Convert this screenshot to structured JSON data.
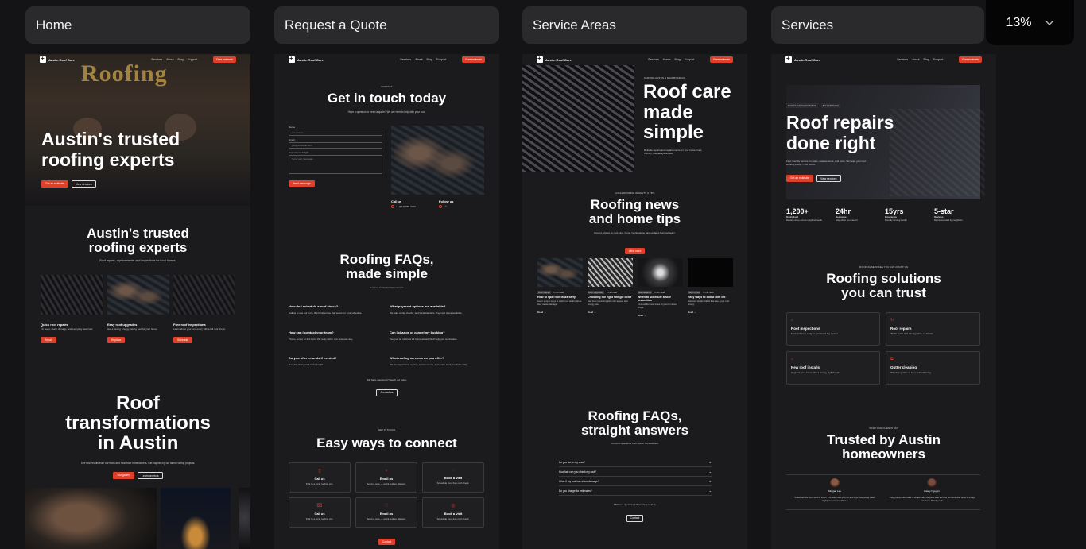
{
  "tabs": [
    {
      "label": "Home"
    },
    {
      "label": "Request a Quote"
    },
    {
      "label": "Service Areas"
    },
    {
      "label": "Services"
    }
  ],
  "zoom": {
    "value": "13%"
  },
  "site": {
    "brand": "Austin Roof Care",
    "cta": "Free estimate",
    "nav_a": [
      "Services",
      "About",
      "Blog",
      "Support"
    ],
    "nav_b": [
      "Services",
      "Home",
      "Blog",
      "Support"
    ]
  },
  "home": {
    "hero_sign": "Roofing",
    "hero_title_1": "Austin's trusted",
    "hero_title_2": "roofing experts",
    "hero_btn_1": "Get an estimate",
    "hero_btn_2": "View services",
    "sec_title_1": "Austin's trusted",
    "sec_title_2": "roofing experts",
    "sec_sub": "Roof repairs, replacements, and inspections for local homes.",
    "cards": [
      {
        "title": "Quick roof repairs",
        "text": "Fix leaks, storm damage, and everyday wear fast.",
        "btn": "Repair"
      },
      {
        "title": "Easy roof upgrades",
        "text": "Get a strong, energy-saving roof for your home.",
        "btn": "Replace"
      },
      {
        "title": "Free roof inspections",
        "text": "Learn about your roof every with a full roof check.",
        "btn": "Schedule"
      }
    ],
    "big_title_1": "Roof",
    "big_title_2": "transformations",
    "big_title_3": "in Austin",
    "big_sub": "See real results from our team and hear from homeowners. Get inspired by our latest roofing projects.",
    "big_btn_1": "Our gallery",
    "big_btn_2": "Learn projects"
  },
  "quote": {
    "kicker": "CONTACT",
    "title": "Get in touch today",
    "sub": "Have a question or need a quote? We are here to help with your roof.",
    "f_name": "Name",
    "f_name_ph": "Your name",
    "f_email": "Email",
    "f_email_ph": "you@example.com",
    "f_msg": "How can we help?",
    "f_msg_ph": "Type your message...",
    "send": "Send message",
    "call_label": "Call us",
    "call_value": "+1 (512) 555-0000",
    "follow_label": "Follow us",
    "faq_title_1": "Roofing FAQs,",
    "faq_title_2": "made simple",
    "faq_sub": "Answers for Austin homeowners.",
    "faqs": [
      {
        "q": "How do I schedule a roof check?",
        "a": "Call us or use our form. We'll find a time that works for your schedule."
      },
      {
        "q": "What payment options are available?",
        "a": "We take cards, checks, and bank transfers. Payment plans available."
      },
      {
        "q": "How can I contact your team?",
        "a": "Phone, email, or this form. We reply within one business day."
      },
      {
        "q": "Can I change or cancel my booking?",
        "a": "Yes, just let us know 24 hours ahead. We'll help you reschedule."
      },
      {
        "q": "Do you offer refunds if needed?",
        "a": "If we fall short, we'll make it right."
      },
      {
        "q": "What roofing services do you offer?",
        "a": "We do inspections, repairs, replacements, and gutter work, available daily."
      }
    ],
    "more_q": "Still have questions? Reach out today.",
    "contact_btn": "Contact us",
    "ways_kicker": "GET IN TOUCH",
    "ways_title": "Easy ways to connect",
    "ways": [
      {
        "title": "Call us",
        "text": "Talk to a local roofing pro."
      },
      {
        "title": "Email us",
        "text": "Send a note — quick replies, always."
      },
      {
        "title": "Book a visit",
        "text": "Schedule your free roof check."
      },
      {
        "title": "Call us",
        "text": "Talk to a local roofing pro."
      },
      {
        "title": "Email us",
        "text": "Send a note — quick replies, always."
      },
      {
        "title": "Book a visit",
        "text": "Schedule your free roof check."
      }
    ],
    "bottom_btn": "Contact"
  },
  "areas": {
    "kicker": "SERVING AUSTIN & NEARBY AREAS",
    "title_1": "Roof care",
    "title_2": "made",
    "title_3": "simple",
    "sub": "Reliable repairs and replacements for your home. Fast, friendly, and always honest.",
    "news_kicker": "LOCAL ROOFING INSIGHTS & TIPS",
    "news_title_1": "Roofing news",
    "news_title_2": "and home tips",
    "news_sub": "Recent articles on roof care, home maintenance, and updates from our team.",
    "news_btn": "View more",
    "posts": [
      {
        "tag": "Roof Repair",
        "time": "5 min read",
        "title": "How to spot roof leaks early",
        "text": "Learn simple ways to catch roof leaks before they cause damage.",
        "read": "Read"
      },
      {
        "tag": "Roof Upgrades",
        "time": "6 min read",
        "title": "Choosing the right shingle color",
        "text": "See how colour impacts curb appeal and energy use.",
        "read": "Read"
      },
      {
        "tag": "Maintenance",
        "time": "4 min read",
        "title": "When to schedule a roof inspection",
        "text": "Find out the best times of year for a roof check.",
        "read": "Read"
      },
      {
        "tag": "Storm Prep",
        "time": "3 min read",
        "title": "Easy ways to boost roof life",
        "text": "Discover simple habits that keep your roof strong.",
        "read": "Read"
      }
    ],
    "faq_title_1": "Roofing FAQs,",
    "faq_title_2": "straight answers",
    "faq_sub": "Common questions from Austin homeowners.",
    "faqs": [
      "Do you serve my area?",
      "How fast can you check my roof?",
      "What if my roof has storm damage?",
      "Do you charge for estimates?"
    ],
    "more_q": "Still have questions? We're here to help.",
    "contact_btn": "Contact"
  },
  "services": {
    "kicker_1": "Austin's local roof solutions",
    "kicker_2": "Free estimates",
    "title_1": "Roof repairs",
    "title_2": "done right",
    "sub": "Fast, friendly service for leaks, replacements, and more. We keep your roof working safely — no stress.",
    "btn_1": "Get an estimate",
    "btn_2": "View services",
    "stats": [
      {
        "value": "1,200+",
        "label": "Roofs fixed",
        "note": "Repairs done across neighborhoods"
      },
      {
        "value": "24hr",
        "label": "Response",
        "note": "Help when you need it"
      },
      {
        "value": "15yrs",
        "label": "Experience",
        "note": "Proudly serving Austin"
      },
      {
        "value": "5-star",
        "label": "Reviews",
        "note": "Recommended by neighbors"
      }
    ],
    "sol_kicker": "ROOFING SERVICES YOU CAN COUNT ON",
    "sol_title_1": "Roofing solutions",
    "sol_title_2": "you can trust",
    "items": [
      {
        "title": "Roof inspections",
        "text": "Find problems early so you avoid big repairs."
      },
      {
        "title": "Roof repairs",
        "text": "We fix leaks and damage fast, no hassle."
      },
      {
        "title": "New roof installs",
        "text": "Upgrade your home with a strong, stylish roof."
      },
      {
        "title": "Gutter cleaning",
        "text": "We clear gutters to keep water flowing."
      }
    ],
    "trust_kicker": "WHAT OUR CLIENTS SAY",
    "trust_title_1": "Trusted by Austin",
    "trust_title_2": "homeowners",
    "reviews": [
      {
        "name": "Morgan Lee",
        "quote": "\"Great service from start to finish. The team was prompt and kept everything clean. Highly recommend them.\""
      },
      {
        "name": "Casey Nguyen",
        "quote": "\"They put our roof back in shape fast, the price was fair and the work was done to a high standard. Thank you!\""
      }
    ]
  },
  "colors": {
    "accent": "#e0402a",
    "bg": "#141316",
    "frame": "#1b1a1d",
    "tab": "#2a292c"
  },
  "icons": {
    "zoom_dropdown": "chevron-down-icon"
  }
}
